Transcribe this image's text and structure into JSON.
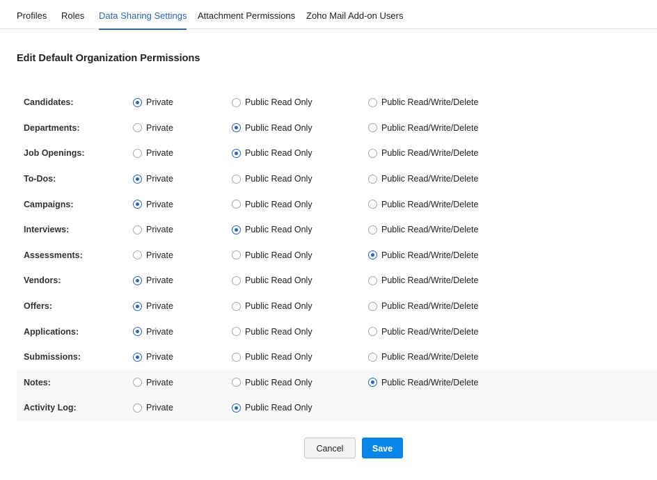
{
  "tabs": [
    {
      "label": "Profiles",
      "active": false
    },
    {
      "label": "Roles",
      "active": false
    },
    {
      "label": "Data Sharing Settings",
      "active": true
    },
    {
      "label": "Attachment Permissions",
      "active": false
    },
    {
      "label": "Zoho Mail Add-on Users",
      "active": false
    }
  ],
  "page_title": "Edit Default Organization Permissions",
  "options": [
    "Private",
    "Public Read Only",
    "Public Read/Write/Delete"
  ],
  "permissions": [
    {
      "module": "Candidates:",
      "selected": "Private"
    },
    {
      "module": "Departments:",
      "selected": "Public Read Only"
    },
    {
      "module": "Job Openings:",
      "selected": "Public Read Only"
    },
    {
      "module": "To-Dos:",
      "selected": "Private"
    },
    {
      "module": "Campaigns:",
      "selected": "Private"
    },
    {
      "module": "Interviews:",
      "selected": "Public Read Only"
    },
    {
      "module": "Assessments:",
      "selected": "Public Read/Write/Delete"
    },
    {
      "module": "Vendors:",
      "selected": "Private"
    },
    {
      "module": "Offers:",
      "selected": "Private"
    },
    {
      "module": "Applications:",
      "selected": "Private"
    },
    {
      "module": "Submissions:",
      "selected": "Private"
    },
    {
      "module": "Notes:",
      "selected": "Public Read/Write/Delete"
    },
    {
      "module": "Activity Log:",
      "selected": "Public Read Only",
      "available_options": [
        "Private",
        "Public Read Only"
      ]
    }
  ],
  "buttons": {
    "cancel": "Cancel",
    "save": "Save"
  },
  "colors": {
    "accent": "#2a64b7",
    "save_button": "#0a86e8"
  }
}
